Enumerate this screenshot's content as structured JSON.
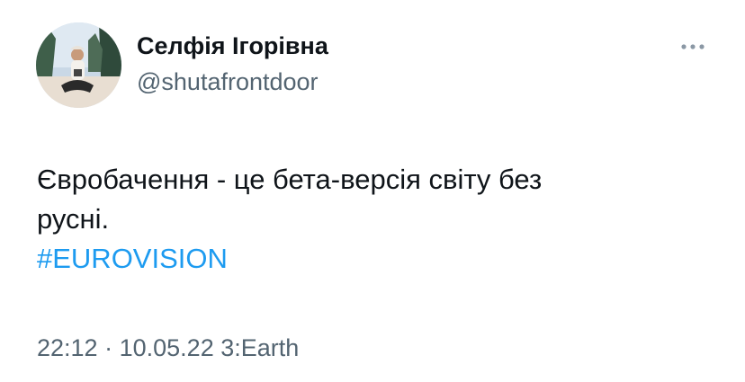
{
  "author": {
    "display_name": "Селфія Ігорівна",
    "handle": "@shutafrontdoor"
  },
  "tweet": {
    "text_line1": "Євробачення - це бета-версія світу без",
    "text_line2": "русні.",
    "hashtag": "#EUROVISION"
  },
  "meta": {
    "time": "22:12",
    "separator": "·",
    "date": "10.05.22",
    "source": "3:Earth"
  },
  "icons": {
    "more": "more-horizontal-icon",
    "avatar": "avatar-photo"
  },
  "colors": {
    "link": "#1d9bf0",
    "secondary": "#536471",
    "text": "#0f1419"
  }
}
